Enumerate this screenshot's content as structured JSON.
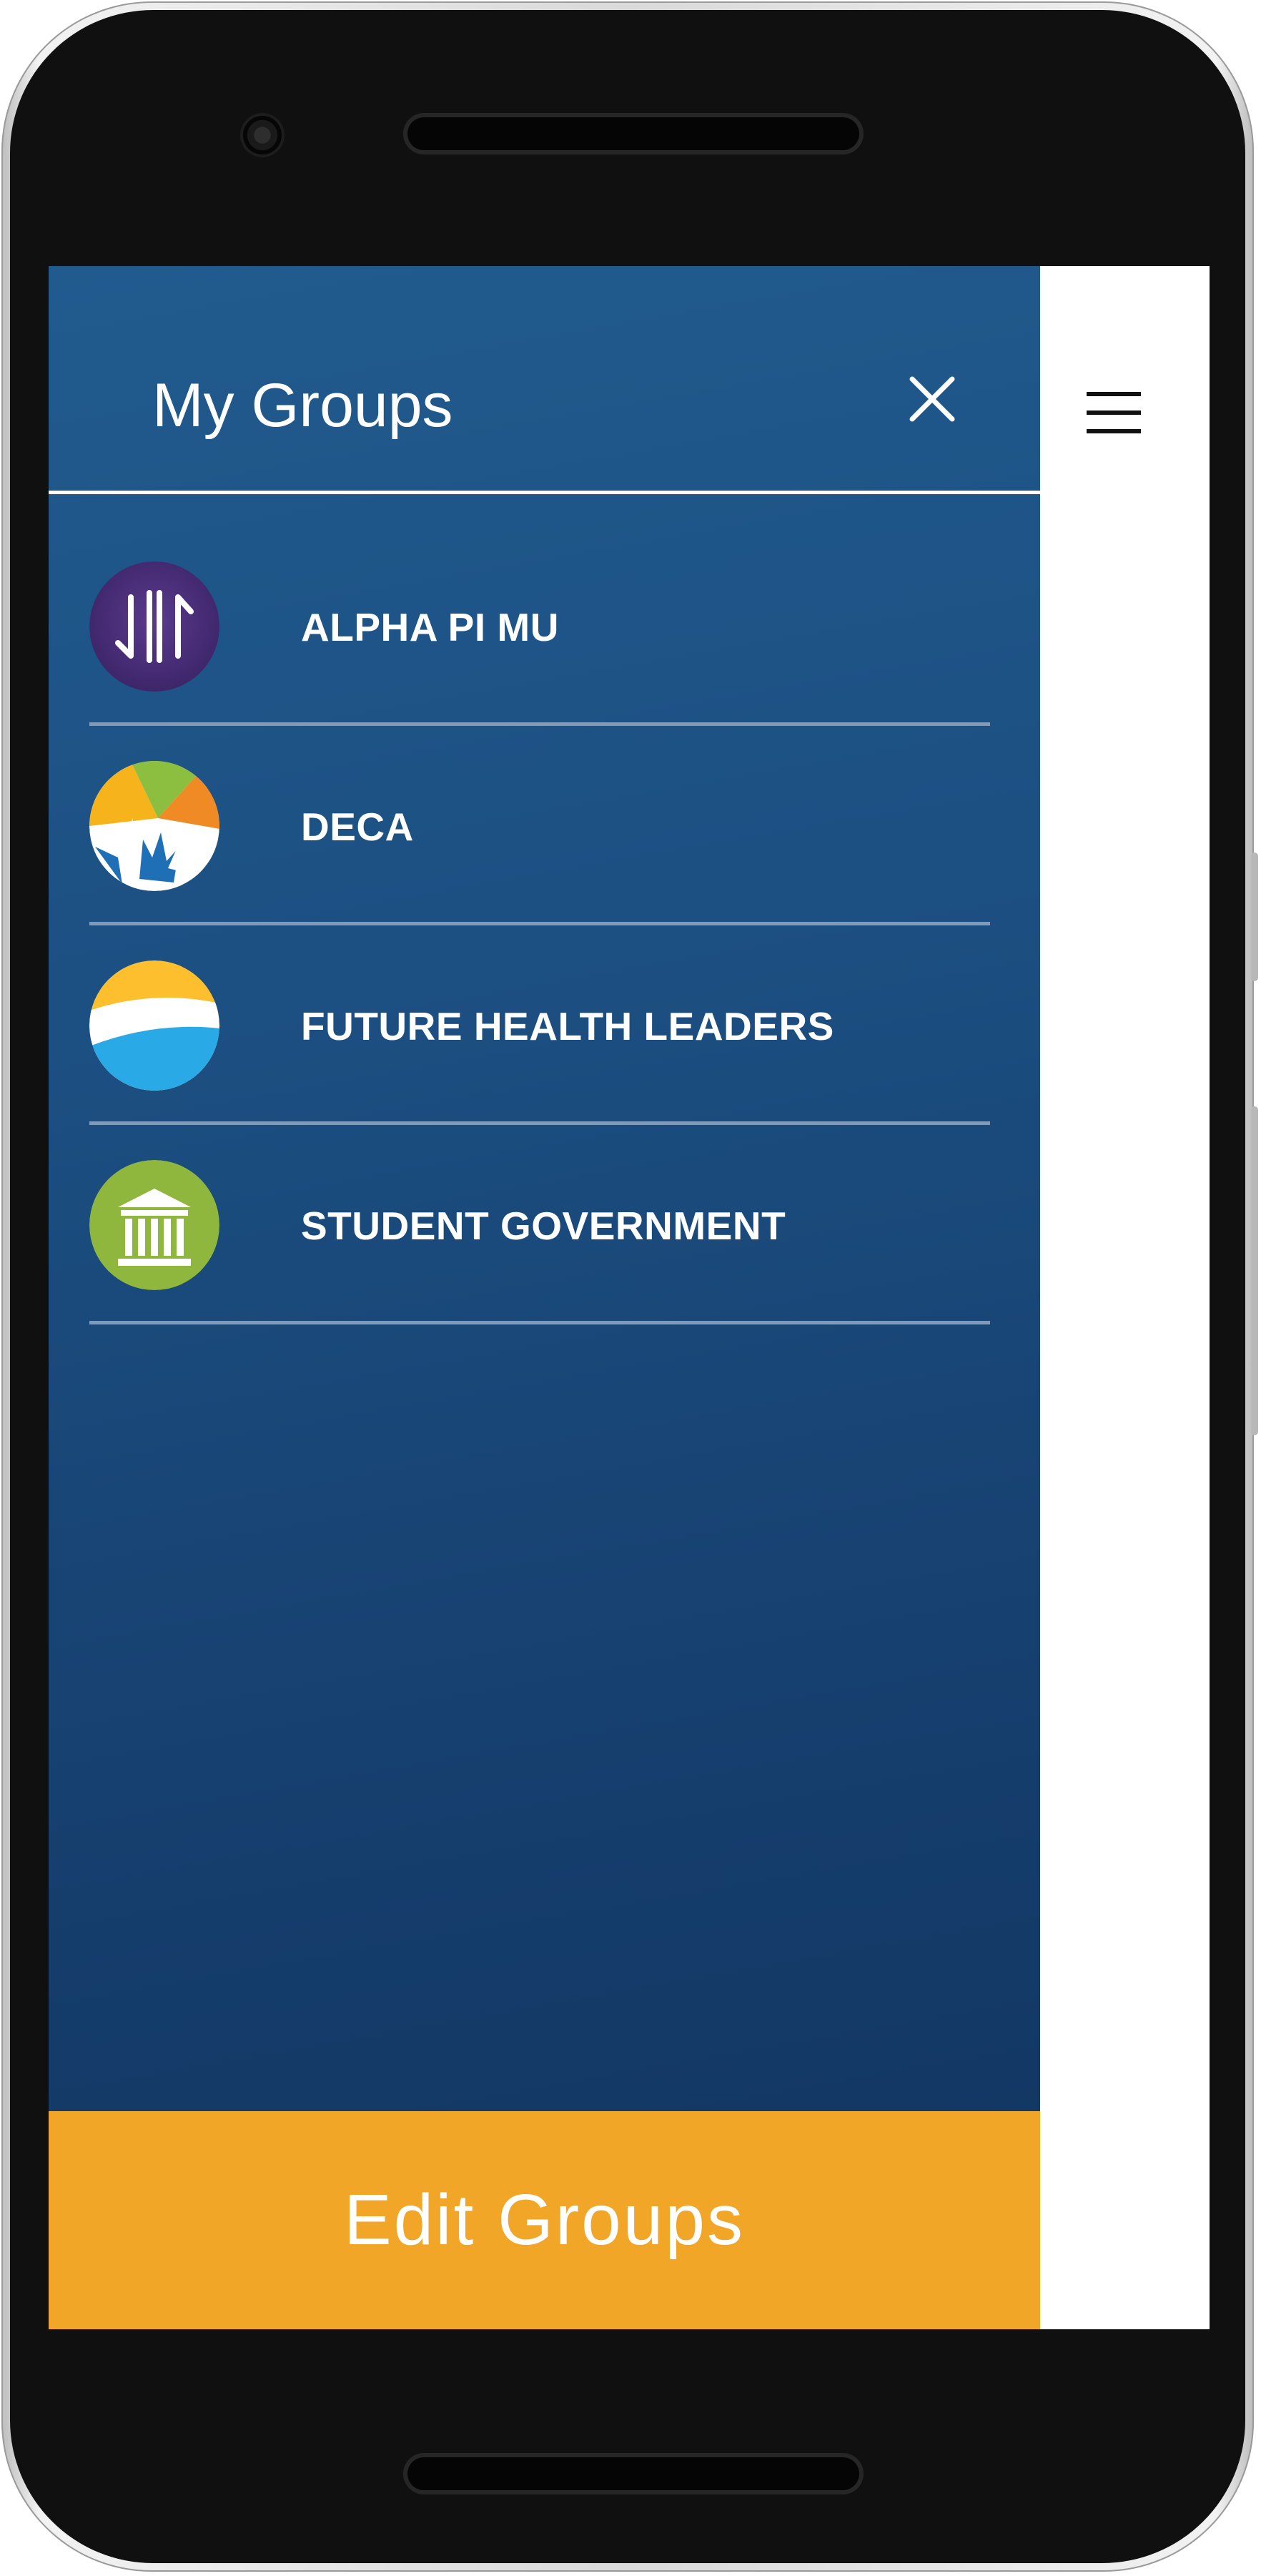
{
  "drawer": {
    "title": "My Groups",
    "close_icon": "close-icon",
    "background_color": "#1c4f82"
  },
  "header": {
    "menu_icon": "hamburger-menu-icon"
  },
  "groups": [
    {
      "label": "ALPHA PI MU",
      "icon": "alpha-pi-mu-logo"
    },
    {
      "label": "DECA",
      "icon": "deca-hands-logo"
    },
    {
      "label": "FUTURE HEALTH LEADERS",
      "icon": "future-health-leaders-logo"
    },
    {
      "label": "STUDENT GOVERNMENT",
      "icon": "student-government-building-logo"
    }
  ],
  "footer": {
    "edit_label": "Edit Groups",
    "accent_color": "#f2a628"
  }
}
